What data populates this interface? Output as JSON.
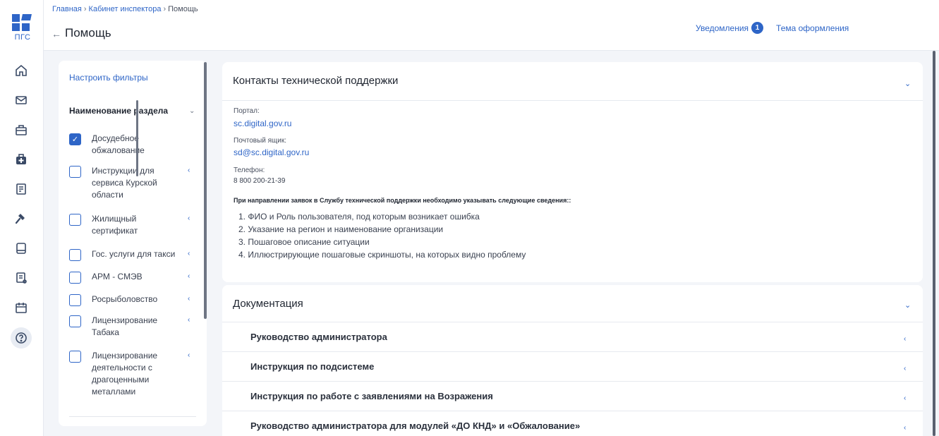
{
  "logo": {
    "text": "ПГС"
  },
  "rail": {
    "icons": [
      "home-icon",
      "mail-icon",
      "briefcase-icon",
      "medkit-icon",
      "registry-icon",
      "gavel-icon",
      "book-icon",
      "report-icon",
      "calendar-icon",
      "help-icon"
    ]
  },
  "header": {
    "breadcrumb": {
      "home": "Главная",
      "cabinet": "Кабинет инспектора",
      "current": "Помощь",
      "separator": "›"
    },
    "back_arrow": "←",
    "title": "Помощь",
    "notifications_label": "Уведомления",
    "notifications_count": "1",
    "theme_label": "Тема оформления"
  },
  "filters": {
    "setup_link": "Настроить фильтры",
    "section_title": "Наименование раздела",
    "items": [
      {
        "label": "Досудебное обжалование",
        "checked": true,
        "has_chevron": false
      },
      {
        "label": "Инструкции для сервиса Курской области",
        "checked": false,
        "has_chevron": true
      },
      {
        "label": "Жилищный сертификат",
        "checked": false,
        "has_chevron": true
      },
      {
        "label": "Гос. услуги для такси",
        "checked": false,
        "has_chevron": true
      },
      {
        "label": "АРМ - СМЭВ",
        "checked": false,
        "has_chevron": true
      },
      {
        "label": "Росрыболовство",
        "checked": false,
        "has_chevron": true
      },
      {
        "label": "Лицензирование Табака",
        "checked": false,
        "has_chevron": true
      },
      {
        "label": "Лицензирование деятельности с драгоценными металлами",
        "checked": false,
        "has_chevron": true
      }
    ]
  },
  "support": {
    "title": "Контакты технической поддержки",
    "portal_label": "Портал:",
    "portal_value": "sc.digital.gov.ru",
    "mailbox_label": "Почтовый ящик:",
    "mailbox_value": "sd@sc.digital.gov.ru",
    "phone_label": "Телефон:",
    "phone_value": "8 800 200-21-39",
    "note": "При направлении заявок в Службу технической поддержки необходимо указывать следующие сведения::",
    "list": [
      "1. ФИО и Роль пользователя, под которым возникает ошибка",
      "2. Указание на регион и наименование организации",
      "3. Пошаговое описание ситуации",
      "4. Иллюстрирующие пошаговые скриншоты, на которых видно проблему"
    ]
  },
  "documentation": {
    "title": "Документация",
    "rows": [
      "Руководство администратора",
      "Инструкция по подсистеме",
      "Инструкция по работе с заявлениями на Возражения",
      "Руководство администратора для модулей «ДО КНД» и «Обжалование»"
    ]
  },
  "colors": {
    "accent": "#2e65c7",
    "background": "#f3f5f9",
    "card": "#ffffff"
  }
}
